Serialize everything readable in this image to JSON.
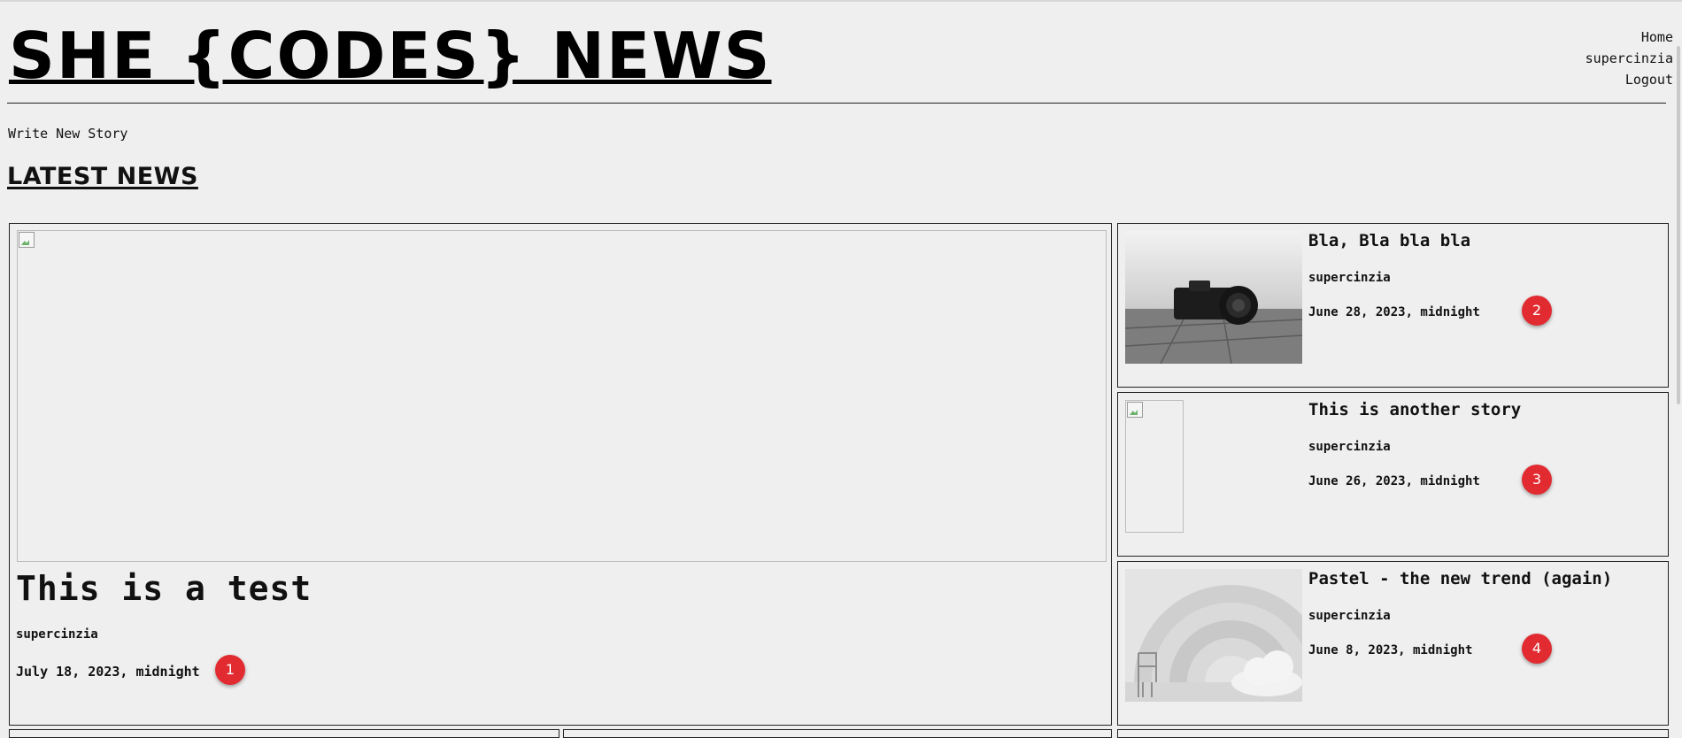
{
  "site": {
    "title": "SHE {CODES} NEWS"
  },
  "nav": {
    "home": "Home",
    "user": "supercinzia",
    "logout": "Logout"
  },
  "actions": {
    "write_story": "Write New Story"
  },
  "section": {
    "title": "LATEST NEWS"
  },
  "stories": [
    {
      "title": "This is a test",
      "author": "supercinzia",
      "date": "July 18, 2023, midnight",
      "marker": "1"
    },
    {
      "title": "Bla, Bla bla bla",
      "author": "supercinzia",
      "date": "June 28, 2023, midnight",
      "marker": "2"
    },
    {
      "title": "This is another story",
      "author": "supercinzia",
      "date": "June 26, 2023, midnight",
      "marker": "3"
    },
    {
      "title": "Pastel - the new trend (again)",
      "author": "supercinzia",
      "date": "June 8, 2023, midnight",
      "marker": "4"
    }
  ],
  "colors": {
    "background": "#efefef",
    "marker": "#e12b31",
    "border": "#222222"
  }
}
